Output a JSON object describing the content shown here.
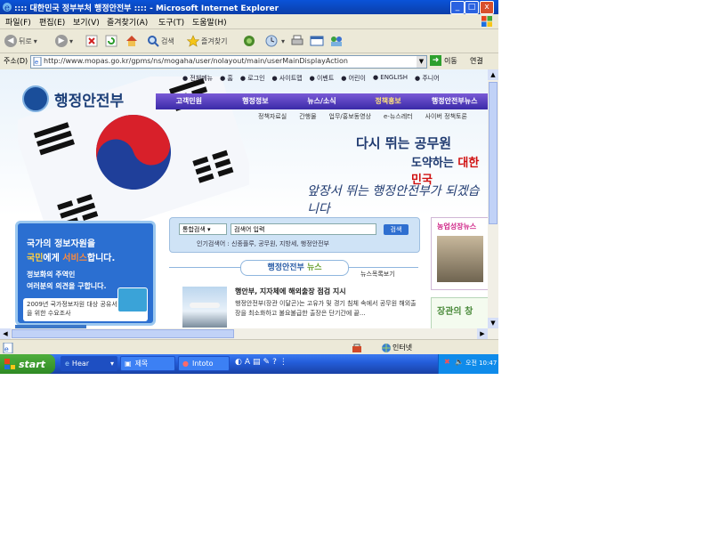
{
  "window": {
    "title": ":::: 대한민국 정부부처 행정안전부 :::: - Microsoft Internet Explorer",
    "controls": {
      "minimize": "_",
      "maximize": "□",
      "close": "x"
    }
  },
  "menu": [
    "파일(F)",
    "편집(E)",
    "보기(V)",
    "즐겨찾기(A)",
    "도구(T)",
    "도움말(H)"
  ],
  "toolbar": {
    "back": "뒤로",
    "search": "검색",
    "favorites": "즐겨찾기"
  },
  "address": {
    "label": "주소(D)",
    "url": "http://www.mopas.go.kr/gpms/ns/mogaha/user/nolayout/main/userMainDisplayAction",
    "go": "이동",
    "links": "연결"
  },
  "site": {
    "logo": "행정안전부",
    "util": [
      "● 전체메뉴",
      "● 홈",
      "● 로그인",
      "● 사이트맵",
      "● 이벤트",
      "● 어린이",
      "● ENGLISH",
      "● 주니어"
    ],
    "nav": [
      "고객민원",
      "행정정보",
      "뉴스/소식",
      "정책홍보",
      "행정안전부뉴스"
    ],
    "subnav": [
      "정책자료실",
      "간행물",
      "업무/홍보동영상",
      "e-뉴스레터",
      "사이버 정책토론"
    ],
    "slogan1": "다시 뛰는 공무원",
    "slogan2_a": "도약하는 ",
    "slogan2_b": "대한민국",
    "slogan3": "앞장서 뛰는 행정안전부가 되겠습니다",
    "panel": {
      "line1": "국가의 정보자원을",
      "line2_a": "국민",
      "line2_b": "에게 ",
      "line2_c": "서비스",
      "line2_d": "합니다.",
      "line3": "정보화의 주역인",
      "line4": "여러분의 의견을 구합니다.",
      "note": "2009년 국가정보자원 대상 공유서비스 도출을 위한 수요조사"
    },
    "search": {
      "select": "통합검색",
      "placeholder": "검색어 입력",
      "button": "검색",
      "hint": "인기검색어 : 신종플루, 공무원, 지방세, 행정안전부"
    },
    "news": {
      "title_a": "행정안전부 ",
      "title_b": "뉴스",
      "more": "뉴스목록보기",
      "headline": "행안부, 지자체에 해외출장 점검 지시",
      "body": "행정안전부(장관 이달곤)는 고유가 및 경기 침체 속에서 공무원 해외출장을 최소화하고 불요불급한 출장은 단기간에 끝..."
    },
    "side1": "농업성장뉴스",
    "side2": "장관의 창"
  },
  "status": {
    "zone": "인터넷"
  },
  "taskbar": {
    "start": "start",
    "tasks": [
      "Hear",
      "제목",
      "Intoto"
    ],
    "clock": "오전 10:47"
  },
  "colors": {
    "title": "#0b4bd0",
    "nav": "#4a34b8",
    "panel": "#2b6fd1",
    "taskbar": "#245edb"
  }
}
